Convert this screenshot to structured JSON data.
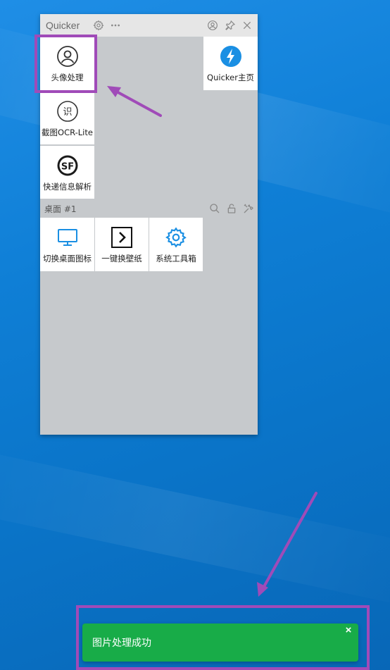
{
  "window": {
    "title": "Quicker"
  },
  "tiles_top": [
    {
      "label": "头像处理",
      "icon": "user-circle-icon"
    },
    {
      "label": "截图OCR-Lite",
      "icon": "ocr-recognize-icon"
    },
    {
      "label": "快递信息解析",
      "icon": "sf-express-icon"
    },
    {
      "label": "Quicker主页",
      "icon": "lightning-bolt-icon"
    }
  ],
  "section": {
    "title": "桌面 #1"
  },
  "tiles_desktop": [
    {
      "label": "切换桌面图标",
      "icon": "monitor-icon"
    },
    {
      "label": "一键换壁纸",
      "icon": "chevron-right-box-icon"
    },
    {
      "label": "系统工具箱",
      "icon": "gear-icon"
    }
  ],
  "toast": {
    "message": "图片处理成功",
    "close": "×"
  },
  "colors": {
    "highlight": "#a04bb8",
    "toast": "#18ac48",
    "accent": "#1a8fe3"
  }
}
